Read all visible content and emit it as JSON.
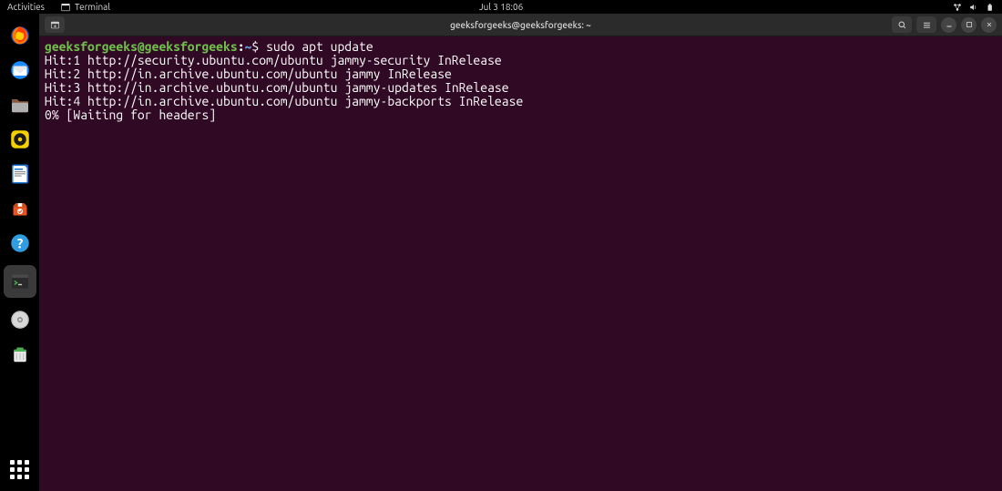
{
  "topbar": {
    "activities": "Activities",
    "app_label": "Terminal",
    "datetime": "Jul 3  18:06"
  },
  "window": {
    "title": "geeksforgeeks@geeksforgeeks: ~"
  },
  "terminal": {
    "prompt_user_host": "geeksforgeeks@geeksforgeeks",
    "prompt_colon": ":",
    "prompt_path": "~",
    "prompt_dollar": "$",
    "command": "sudo apt update",
    "output_lines": [
      "Hit:1 http://security.ubuntu.com/ubuntu jammy-security InRelease",
      "Hit:2 http://in.archive.ubuntu.com/ubuntu jammy InRelease",
      "Hit:3 http://in.archive.ubuntu.com/ubuntu jammy-updates InRelease",
      "Hit:4 http://in.archive.ubuntu.com/ubuntu jammy-backports InRelease"
    ],
    "status_line": "0% [Waiting for headers]"
  },
  "dock": {
    "items": [
      {
        "name": "firefox"
      },
      {
        "name": "thunderbird"
      },
      {
        "name": "files"
      },
      {
        "name": "rhythmbox"
      },
      {
        "name": "libreoffice-writer"
      },
      {
        "name": "ubuntu-software"
      },
      {
        "name": "help"
      },
      {
        "name": "terminal",
        "active": true
      },
      {
        "name": "disk"
      },
      {
        "name": "trash"
      }
    ]
  }
}
